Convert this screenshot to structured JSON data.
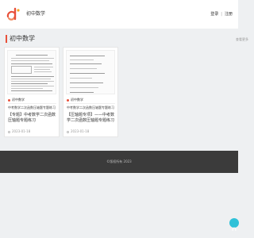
{
  "header": {
    "site_name": "初中数学",
    "login_label": "登录",
    "separator": "|",
    "register_label": "注册",
    "logo_icon": "brand-logo-icon",
    "accent_color": "#e8503a"
  },
  "category": {
    "title": "初中数学",
    "more_label": "查看更多"
  },
  "cards": [
    {
      "tag": "初中数学",
      "subtitle": "中考数学二次函数压轴题专题练习",
      "title": "【专题】中考数学二次函数压轴题专题练习",
      "date": "2023-01-18"
    },
    {
      "tag": "初中数学",
      "subtitle": "中考数学二次函数压轴题专题练习",
      "title": "【压轴题专项】——中考数学二次函数压轴题专题练习",
      "date": "2023-01-18"
    }
  ],
  "footer": {
    "copyright": "©版权所有 2023"
  },
  "float_button": {
    "icon": "customer-service-icon",
    "color": "#2fc1d8"
  }
}
